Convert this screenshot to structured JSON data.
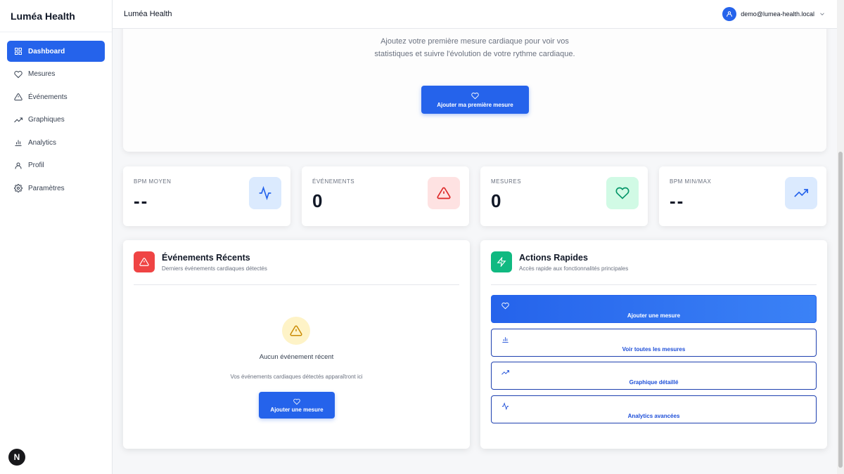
{
  "app": {
    "brand": "Luméa Health",
    "header_title": "Luméa Health"
  },
  "user": {
    "email": "demo@lumea-health.local"
  },
  "sidebar": {
    "items": [
      {
        "label": "Dashboard",
        "icon": "dashboard-icon",
        "active": true
      },
      {
        "label": "Mesures",
        "icon": "heart-icon"
      },
      {
        "label": "Événements",
        "icon": "warning-icon"
      },
      {
        "label": "Graphiques",
        "icon": "trend-icon"
      },
      {
        "label": "Analytics",
        "icon": "bar-chart-icon"
      },
      {
        "label": "Profil",
        "icon": "user-icon"
      },
      {
        "label": "Paramètres",
        "icon": "gear-icon"
      }
    ],
    "badge": "N"
  },
  "hero": {
    "text": "Ajoutez votre première mesure cardiaque pour voir vos statistiques et suivre l'évolution de votre rythme cardiaque.",
    "button": "Ajouter ma première mesure"
  },
  "stats": [
    {
      "label": "BPM MOYEN",
      "value": "--",
      "icon": "pulse-icon",
      "color": "#2563eb",
      "bg": "#dbeafe"
    },
    {
      "label": "ÉVÉNEMENTS",
      "value": "0",
      "icon": "warning-icon",
      "color": "#dc2626",
      "bg": "#fee2e2"
    },
    {
      "label": "MESURES",
      "value": "0",
      "icon": "heart-icon",
      "color": "#059669",
      "bg": "#d1fae5"
    },
    {
      "label": "BPM MIN/MAX",
      "value": "--",
      "icon": "trend-icon",
      "color": "#2563eb",
      "bg": "#dbeafe"
    }
  ],
  "events_card": {
    "title": "Événements Récents",
    "subtitle": "Derniers événements cardiaques détectés",
    "empty_title": "Aucun événement récent",
    "empty_text": "Vos événements cardiaques détectés apparaîtront ici",
    "button": "Ajouter une mesure",
    "accent": "#ef4444"
  },
  "actions_card": {
    "title": "Actions Rapides",
    "subtitle": "Accès rapide aux fonctionnalités principales",
    "accent": "#10b981",
    "actions": [
      {
        "label": "Ajouter une mesure",
        "icon": "heart-icon"
      },
      {
        "label": "Voir toutes les mesures",
        "icon": "bar-chart-icon"
      },
      {
        "label": "Graphique détaillé",
        "icon": "trend-icon"
      },
      {
        "label": "Analytics avancées",
        "icon": "pulse-icon"
      }
    ]
  }
}
